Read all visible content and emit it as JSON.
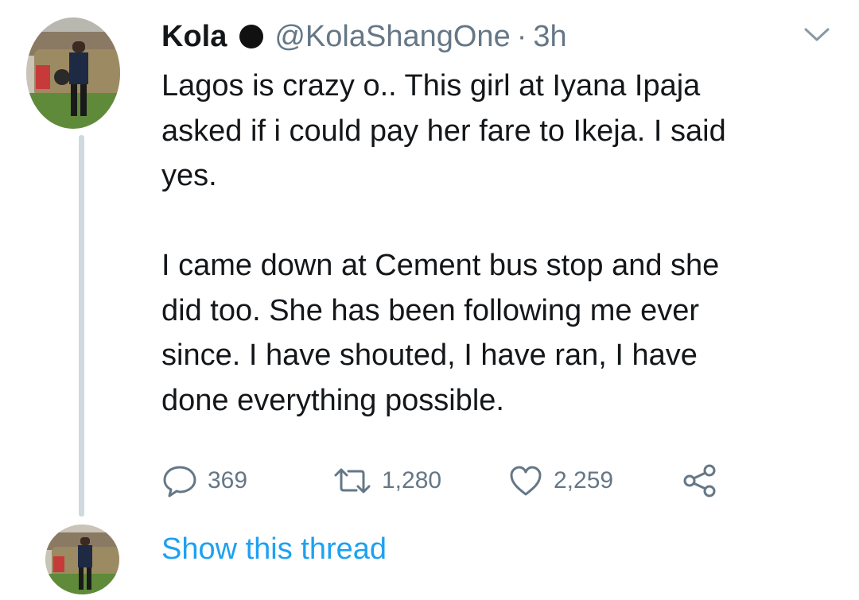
{
  "tweet": {
    "author_name": "Kola",
    "handle": "@KolaShangOne",
    "separator": "·",
    "time": "3h",
    "text": "Lagos is crazy o.. This girl at Iyana Ipaja\nasked if i could pay her fare to Ikeja. I said\nyes.\n\nI came down at Cement bus stop and she\ndid too. She has been following me ever\nsince. I have shouted, I have ran, I have\ndone everything possible.",
    "replies": "369",
    "retweets": "1,280",
    "likes": "2,259"
  },
  "thread": {
    "show_label": "Show this thread"
  },
  "icons": {
    "verified_badge": "black-dot-icon",
    "menu": "chevron-down-icon",
    "reply": "speech-bubble-icon",
    "retweet": "retweet-icon",
    "like": "heart-icon",
    "share": "share-icon"
  },
  "colors": {
    "text": "#14171a",
    "muted": "#657786",
    "link": "#1da1f2",
    "thread_line": "#cfd9de"
  }
}
